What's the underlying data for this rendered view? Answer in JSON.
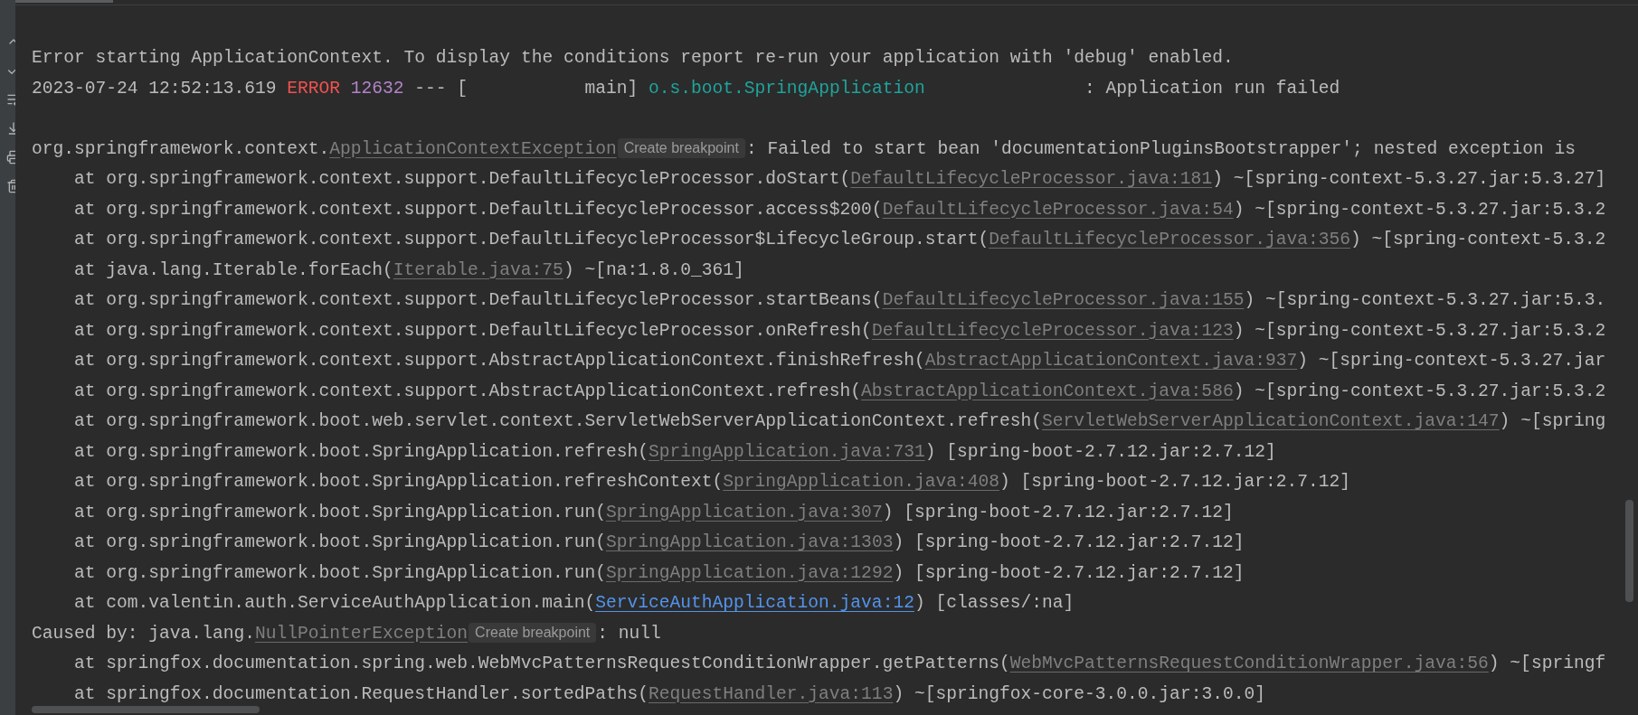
{
  "console": {
    "lines": [
      {
        "kind": "message",
        "segments": [
          {
            "kind": "text",
            "text": "Error starting ApplicationContext. To display the conditions report re-run your application with 'debug' enabled."
          }
        ]
      },
      {
        "kind": "message",
        "segments": [
          {
            "kind": "text",
            "text": "2023-07-24 12:52:13.619 "
          },
          {
            "kind": "level",
            "text": "ERROR"
          },
          {
            "kind": "pid",
            "text": "12632"
          },
          {
            "kind": "text",
            "text": " --- [           main] "
          },
          {
            "kind": "logger",
            "text": "o.s.boot.SpringApplication              "
          },
          {
            "kind": "text",
            "text": " : Application run failed"
          }
        ]
      },
      {
        "kind": "blank"
      },
      {
        "kind": "message",
        "segments": [
          {
            "kind": "text",
            "text": "org.springframework.context."
          },
          {
            "kind": "link",
            "text": "ApplicationContextException"
          },
          {
            "kind": "hint",
            "text": "Create breakpoint"
          },
          {
            "kind": "text",
            "text": ": Failed to start bean 'documentationPluginsBootstrapper'; nested exception is"
          }
        ]
      },
      {
        "kind": "frame",
        "segments": [
          {
            "kind": "text",
            "text": "at org.springframework.context.support.DefaultLifecycleProcessor.doStart("
          },
          {
            "kind": "link",
            "text": "DefaultLifecycleProcessor.java:181"
          },
          {
            "kind": "text",
            "text": ") ~[spring-context-5.3.27.jar:5.3.27]"
          }
        ]
      },
      {
        "kind": "frame",
        "segments": [
          {
            "kind": "text",
            "text": "at org.springframework.context.support.DefaultLifecycleProcessor.access$200("
          },
          {
            "kind": "link",
            "text": "DefaultLifecycleProcessor.java:54"
          },
          {
            "kind": "text",
            "text": ") ~[spring-context-5.3.27.jar:5.3.2"
          }
        ]
      },
      {
        "kind": "frame",
        "segments": [
          {
            "kind": "text",
            "text": "at org.springframework.context.support.DefaultLifecycleProcessor$LifecycleGroup.start("
          },
          {
            "kind": "link",
            "text": "DefaultLifecycleProcessor.java:356"
          },
          {
            "kind": "text",
            "text": ") ~[spring-context-5.3.2"
          }
        ]
      },
      {
        "kind": "frame",
        "segments": [
          {
            "kind": "text",
            "text": "at java.lang.Iterable.forEach("
          },
          {
            "kind": "link",
            "text": "Iterable.java:75"
          },
          {
            "kind": "text",
            "text": ") ~[na:1.8.0_361]"
          }
        ]
      },
      {
        "kind": "frame",
        "segments": [
          {
            "kind": "text",
            "text": "at org.springframework.context.support.DefaultLifecycleProcessor.startBeans("
          },
          {
            "kind": "link",
            "text": "DefaultLifecycleProcessor.java:155"
          },
          {
            "kind": "text",
            "text": ") ~[spring-context-5.3.27.jar:5.3."
          }
        ]
      },
      {
        "kind": "frame",
        "segments": [
          {
            "kind": "text",
            "text": "at org.springframework.context.support.DefaultLifecycleProcessor.onRefresh("
          },
          {
            "kind": "link",
            "text": "DefaultLifecycleProcessor.java:123"
          },
          {
            "kind": "text",
            "text": ") ~[spring-context-5.3.27.jar:5.3.2"
          }
        ]
      },
      {
        "kind": "frame",
        "segments": [
          {
            "kind": "text",
            "text": "at org.springframework.context.support.AbstractApplicationContext.finishRefresh("
          },
          {
            "kind": "link",
            "text": "AbstractApplicationContext.java:937"
          },
          {
            "kind": "text",
            "text": ") ~[spring-context-5.3.27.jar"
          }
        ]
      },
      {
        "kind": "frame",
        "segments": [
          {
            "kind": "text",
            "text": "at org.springframework.context.support.AbstractApplicationContext.refresh("
          },
          {
            "kind": "link",
            "text": "AbstractApplicationContext.java:586"
          },
          {
            "kind": "text",
            "text": ") ~[spring-context-5.3.27.jar:5.3.2"
          }
        ]
      },
      {
        "kind": "frame",
        "segments": [
          {
            "kind": "text",
            "text": "at org.springframework.boot.web.servlet.context.ServletWebServerApplicationContext.refresh("
          },
          {
            "kind": "link",
            "text": "ServletWebServerApplicationContext.java:147"
          },
          {
            "kind": "text",
            "text": ") ~[spring"
          }
        ]
      },
      {
        "kind": "frame",
        "segments": [
          {
            "kind": "text",
            "text": "at org.springframework.boot.SpringApplication.refresh("
          },
          {
            "kind": "link",
            "text": "SpringApplication.java:731"
          },
          {
            "kind": "text",
            "text": ") [spring-boot-2.7.12.jar:2.7.12]"
          }
        ]
      },
      {
        "kind": "frame",
        "segments": [
          {
            "kind": "text",
            "text": "at org.springframework.boot.SpringApplication.refreshContext("
          },
          {
            "kind": "link",
            "text": "SpringApplication.java:408"
          },
          {
            "kind": "text",
            "text": ") [spring-boot-2.7.12.jar:2.7.12]"
          }
        ]
      },
      {
        "kind": "frame",
        "segments": [
          {
            "kind": "text",
            "text": "at org.springframework.boot.SpringApplication.run("
          },
          {
            "kind": "link",
            "text": "SpringApplication.java:307"
          },
          {
            "kind": "text",
            "text": ") [spring-boot-2.7.12.jar:2.7.12]"
          }
        ]
      },
      {
        "kind": "frame",
        "segments": [
          {
            "kind": "text",
            "text": "at org.springframework.boot.SpringApplication.run("
          },
          {
            "kind": "link",
            "text": "SpringApplication.java:1303"
          },
          {
            "kind": "text",
            "text": ") [spring-boot-2.7.12.jar:2.7.12]"
          }
        ]
      },
      {
        "kind": "frame",
        "segments": [
          {
            "kind": "text",
            "text": "at org.springframework.boot.SpringApplication.run("
          },
          {
            "kind": "link",
            "text": "SpringApplication.java:1292"
          },
          {
            "kind": "text",
            "text": ") [spring-boot-2.7.12.jar:2.7.12]"
          }
        ]
      },
      {
        "kind": "frame",
        "segments": [
          {
            "kind": "text",
            "text": "at com.valentin.auth.ServiceAuthApplication.main("
          },
          {
            "kind": "project_link",
            "text": "ServiceAuthApplication.java:12"
          },
          {
            "kind": "text",
            "text": ") [classes/:na]"
          }
        ]
      },
      {
        "kind": "message",
        "segments": [
          {
            "kind": "text",
            "text": "Caused by: java.lang."
          },
          {
            "kind": "link",
            "text": "NullPointerException"
          },
          {
            "kind": "hint",
            "text": "Create breakpoint"
          },
          {
            "kind": "text",
            "text": ": null"
          }
        ]
      },
      {
        "kind": "frame",
        "segments": [
          {
            "kind": "text",
            "text": "at springfox.documentation.spring.web.WebMvcPatternsRequestConditionWrapper.getPatterns("
          },
          {
            "kind": "link",
            "text": "WebMvcPatternsRequestConditionWrapper.java:56"
          },
          {
            "kind": "text",
            "text": ") ~[springf"
          }
        ]
      },
      {
        "kind": "frame",
        "segments": [
          {
            "kind": "text",
            "text": "at springfox.documentation.RequestHandler.sortedPaths("
          },
          {
            "kind": "link",
            "text": "RequestHandler.java:113"
          },
          {
            "kind": "text",
            "text": ") ~[springfox-core-3.0.0.jar:3.0.0]"
          }
        ]
      }
    ]
  }
}
